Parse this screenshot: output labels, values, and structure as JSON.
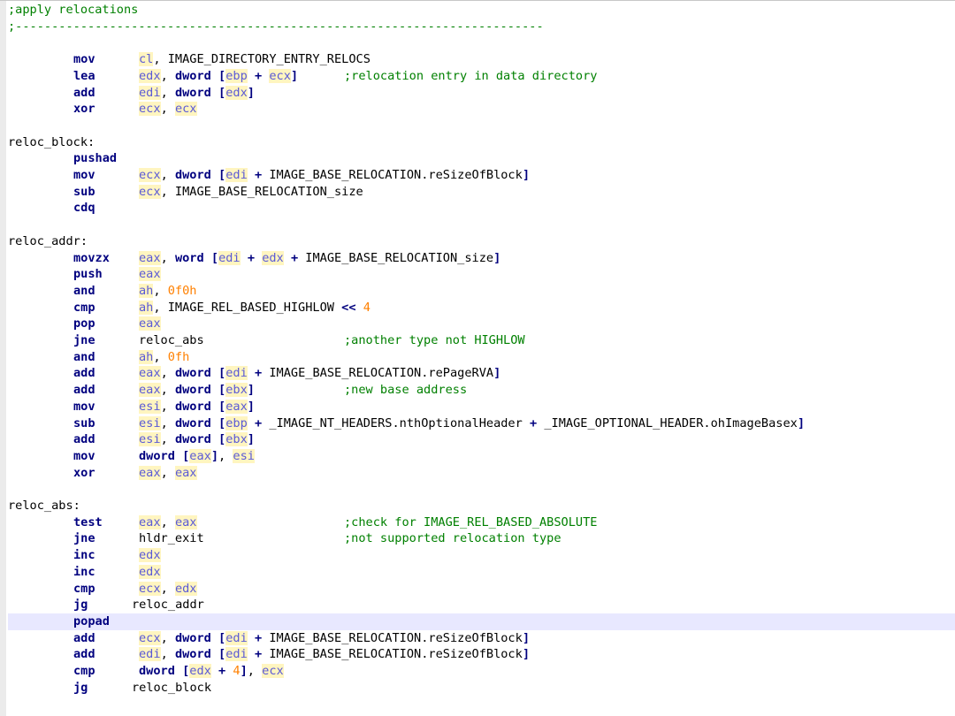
{
  "editor": {
    "lines": [
      {
        "type": "comment",
        "text": ";apply relocations"
      },
      {
        "type": "comment",
        "text": ";-------------------------------------------------------------------------"
      },
      {
        "type": "blank"
      },
      {
        "type": "instr",
        "mnemonic": "mov",
        "operands": [
          {
            "k": "reg",
            "t": "cl"
          },
          {
            "k": "plain",
            "t": ", IMAGE_DIRECTORY_ENTRY_RELOCS"
          }
        ]
      },
      {
        "type": "instr",
        "mnemonic": "lea",
        "operands": [
          {
            "k": "reg",
            "t": "edx"
          },
          {
            "k": "plain",
            "t": ", "
          },
          {
            "k": "kw",
            "t": "dword"
          },
          {
            "k": "plain",
            "t": " "
          },
          {
            "k": "kw",
            "t": "["
          },
          {
            "k": "reg",
            "t": "ebp"
          },
          {
            "k": "plain",
            "t": " "
          },
          {
            "k": "kw",
            "t": "+"
          },
          {
            "k": "plain",
            "t": " "
          },
          {
            "k": "reg",
            "t": "ecx"
          },
          {
            "k": "kw",
            "t": "]"
          }
        ],
        "comment": ";relocation entry in data directory"
      },
      {
        "type": "instr",
        "mnemonic": "add",
        "operands": [
          {
            "k": "reg",
            "t": "edi"
          },
          {
            "k": "plain",
            "t": ", "
          },
          {
            "k": "kw",
            "t": "dword"
          },
          {
            "k": "plain",
            "t": " "
          },
          {
            "k": "kw",
            "t": "["
          },
          {
            "k": "reg",
            "t": "edx"
          },
          {
            "k": "kw",
            "t": "]"
          }
        ]
      },
      {
        "type": "instr",
        "mnemonic": "xor",
        "operands": [
          {
            "k": "reg",
            "t": "ecx"
          },
          {
            "k": "plain",
            "t": ", "
          },
          {
            "k": "reg",
            "t": "ecx"
          }
        ]
      },
      {
        "type": "blank"
      },
      {
        "type": "label",
        "text": "reloc_block:"
      },
      {
        "type": "instr",
        "mnemonic": "pushad",
        "operands": []
      },
      {
        "type": "instr",
        "mnemonic": "mov",
        "operands": [
          {
            "k": "reg",
            "t": "ecx"
          },
          {
            "k": "plain",
            "t": ", "
          },
          {
            "k": "kw",
            "t": "dword"
          },
          {
            "k": "plain",
            "t": " "
          },
          {
            "k": "kw",
            "t": "["
          },
          {
            "k": "reg",
            "t": "edi"
          },
          {
            "k": "plain",
            "t": " "
          },
          {
            "k": "kw",
            "t": "+"
          },
          {
            "k": "plain",
            "t": " IMAGE_BASE_RELOCATION.reSizeOfBlock"
          },
          {
            "k": "kw",
            "t": "]"
          }
        ]
      },
      {
        "type": "instr",
        "mnemonic": "sub",
        "operands": [
          {
            "k": "reg",
            "t": "ecx"
          },
          {
            "k": "plain",
            "t": ", IMAGE_BASE_RELOCATION_size"
          }
        ]
      },
      {
        "type": "instr",
        "mnemonic": "cdq",
        "operands": []
      },
      {
        "type": "blank"
      },
      {
        "type": "label",
        "text": "reloc_addr:"
      },
      {
        "type": "instr",
        "mnemonic": "movzx",
        "operands": [
          {
            "k": "reg",
            "t": "eax"
          },
          {
            "k": "plain",
            "t": ", "
          },
          {
            "k": "kw",
            "t": "word"
          },
          {
            "k": "plain",
            "t": " "
          },
          {
            "k": "kw",
            "t": "["
          },
          {
            "k": "reg",
            "t": "edi"
          },
          {
            "k": "plain",
            "t": " "
          },
          {
            "k": "kw",
            "t": "+"
          },
          {
            "k": "plain",
            "t": " "
          },
          {
            "k": "reg",
            "t": "edx"
          },
          {
            "k": "plain",
            "t": " "
          },
          {
            "k": "kw",
            "t": "+"
          },
          {
            "k": "plain",
            "t": " IMAGE_BASE_RELOCATION_size"
          },
          {
            "k": "kw",
            "t": "]"
          }
        ]
      },
      {
        "type": "instr",
        "mnemonic": "push",
        "operands": [
          {
            "k": "reg",
            "t": "eax"
          }
        ]
      },
      {
        "type": "instr",
        "mnemonic": "and",
        "operands": [
          {
            "k": "reg",
            "t": "ah"
          },
          {
            "k": "plain",
            "t": ", "
          },
          {
            "k": "num",
            "t": "0f0h"
          }
        ]
      },
      {
        "type": "instr",
        "mnemonic": "cmp",
        "operands": [
          {
            "k": "reg",
            "t": "ah"
          },
          {
            "k": "plain",
            "t": ", IMAGE_REL_BASED_HIGHLOW "
          },
          {
            "k": "kw",
            "t": "<<"
          },
          {
            "k": "plain",
            "t": " "
          },
          {
            "k": "num",
            "t": "4"
          }
        ]
      },
      {
        "type": "instr",
        "mnemonic": "pop",
        "operands": [
          {
            "k": "reg",
            "t": "eax"
          }
        ]
      },
      {
        "type": "instr",
        "mnemonic": "jne",
        "operands": [
          {
            "k": "plain",
            "t": "reloc_abs"
          }
        ],
        "comment": ";another type not HIGHLOW"
      },
      {
        "type": "instr",
        "mnemonic": "and",
        "operands": [
          {
            "k": "reg",
            "t": "ah"
          },
          {
            "k": "plain",
            "t": ", "
          },
          {
            "k": "num",
            "t": "0fh"
          }
        ]
      },
      {
        "type": "instr",
        "mnemonic": "add",
        "operands": [
          {
            "k": "reg",
            "t": "eax"
          },
          {
            "k": "plain",
            "t": ", "
          },
          {
            "k": "kw",
            "t": "dword"
          },
          {
            "k": "plain",
            "t": " "
          },
          {
            "k": "kw",
            "t": "["
          },
          {
            "k": "reg",
            "t": "edi"
          },
          {
            "k": "plain",
            "t": " "
          },
          {
            "k": "kw",
            "t": "+"
          },
          {
            "k": "plain",
            "t": " IMAGE_BASE_RELOCATION.rePageRVA"
          },
          {
            "k": "kw",
            "t": "]"
          }
        ]
      },
      {
        "type": "instr",
        "mnemonic": "add",
        "operands": [
          {
            "k": "reg",
            "t": "eax"
          },
          {
            "k": "plain",
            "t": ", "
          },
          {
            "k": "kw",
            "t": "dword"
          },
          {
            "k": "plain",
            "t": " "
          },
          {
            "k": "kw",
            "t": "["
          },
          {
            "k": "reg",
            "t": "ebx"
          },
          {
            "k": "kw",
            "t": "]"
          }
        ],
        "comment": ";new base address"
      },
      {
        "type": "instr",
        "mnemonic": "mov",
        "operands": [
          {
            "k": "reg",
            "t": "esi"
          },
          {
            "k": "plain",
            "t": ", "
          },
          {
            "k": "kw",
            "t": "dword"
          },
          {
            "k": "plain",
            "t": " "
          },
          {
            "k": "kw",
            "t": "["
          },
          {
            "k": "reg",
            "t": "eax"
          },
          {
            "k": "kw",
            "t": "]"
          }
        ]
      },
      {
        "type": "instr",
        "mnemonic": "sub",
        "operands": [
          {
            "k": "reg",
            "t": "esi"
          },
          {
            "k": "plain",
            "t": ", "
          },
          {
            "k": "kw",
            "t": "dword"
          },
          {
            "k": "plain",
            "t": " "
          },
          {
            "k": "kw",
            "t": "["
          },
          {
            "k": "reg",
            "t": "ebp"
          },
          {
            "k": "plain",
            "t": " "
          },
          {
            "k": "kw",
            "t": "+"
          },
          {
            "k": "plain",
            "t": " _IMAGE_NT_HEADERS.nthOptionalHeader "
          },
          {
            "k": "kw",
            "t": "+"
          },
          {
            "k": "plain",
            "t": " _IMAGE_OPTIONAL_HEADER.ohImageBasex"
          },
          {
            "k": "kw",
            "t": "]"
          }
        ]
      },
      {
        "type": "instr",
        "mnemonic": "add",
        "operands": [
          {
            "k": "reg",
            "t": "esi"
          },
          {
            "k": "plain",
            "t": ", "
          },
          {
            "k": "kw",
            "t": "dword"
          },
          {
            "k": "plain",
            "t": " "
          },
          {
            "k": "kw",
            "t": "["
          },
          {
            "k": "reg",
            "t": "ebx"
          },
          {
            "k": "kw",
            "t": "]"
          }
        ]
      },
      {
        "type": "instr",
        "mnemonic": "mov",
        "operands": [
          {
            "k": "kw",
            "t": "dword"
          },
          {
            "k": "plain",
            "t": " "
          },
          {
            "k": "kw",
            "t": "["
          },
          {
            "k": "reg",
            "t": "eax"
          },
          {
            "k": "kw",
            "t": "]"
          },
          {
            "k": "plain",
            "t": ", "
          },
          {
            "k": "reg",
            "t": "esi"
          }
        ]
      },
      {
        "type": "instr",
        "mnemonic": "xor",
        "operands": [
          {
            "k": "reg",
            "t": "eax"
          },
          {
            "k": "plain",
            "t": ", "
          },
          {
            "k": "reg",
            "t": "eax"
          }
        ]
      },
      {
        "type": "blank"
      },
      {
        "type": "label",
        "text": "reloc_abs:"
      },
      {
        "type": "instr",
        "mnemonic": "test",
        "operands": [
          {
            "k": "reg",
            "t": "eax"
          },
          {
            "k": "plain",
            "t": ", "
          },
          {
            "k": "reg",
            "t": "eax"
          }
        ],
        "comment": ";check for IMAGE_REL_BASED_ABSOLUTE"
      },
      {
        "type": "instr",
        "mnemonic": "jne",
        "operands": [
          {
            "k": "plain",
            "t": "hldr_exit"
          }
        ],
        "comment": ";not supported relocation type"
      },
      {
        "type": "instr",
        "mnemonic": "inc",
        "operands": [
          {
            "k": "reg",
            "t": "edx"
          }
        ]
      },
      {
        "type": "instr",
        "mnemonic": "inc",
        "operands": [
          {
            "k": "reg",
            "t": "edx"
          }
        ]
      },
      {
        "type": "instr",
        "mnemonic": "cmp",
        "operands": [
          {
            "k": "reg",
            "t": "ecx"
          },
          {
            "k": "plain",
            "t": ", "
          },
          {
            "k": "reg",
            "t": "edx"
          }
        ]
      },
      {
        "type": "instr",
        "mnemonic": "jg",
        "operands": [
          {
            "k": "plain",
            "t": "reloc_addr"
          }
        ],
        "indent": "short"
      },
      {
        "type": "instr",
        "mnemonic": "popad",
        "operands": [],
        "current": true
      },
      {
        "type": "instr",
        "mnemonic": "add",
        "operands": [
          {
            "k": "reg",
            "t": "ecx"
          },
          {
            "k": "plain",
            "t": ", "
          },
          {
            "k": "kw",
            "t": "dword"
          },
          {
            "k": "plain",
            "t": " "
          },
          {
            "k": "kw",
            "t": "["
          },
          {
            "k": "reg",
            "t": "edi"
          },
          {
            "k": "plain",
            "t": " "
          },
          {
            "k": "kw",
            "t": "+"
          },
          {
            "k": "plain",
            "t": " IMAGE_BASE_RELOCATION.reSizeOfBlock"
          },
          {
            "k": "kw",
            "t": "]"
          }
        ]
      },
      {
        "type": "instr",
        "mnemonic": "add",
        "operands": [
          {
            "k": "reg",
            "t": "edi"
          },
          {
            "k": "plain",
            "t": ", "
          },
          {
            "k": "kw",
            "t": "dword"
          },
          {
            "k": "plain",
            "t": " "
          },
          {
            "k": "kw",
            "t": "["
          },
          {
            "k": "reg",
            "t": "edi"
          },
          {
            "k": "plain",
            "t": " "
          },
          {
            "k": "kw",
            "t": "+"
          },
          {
            "k": "plain",
            "t": " IMAGE_BASE_RELOCATION.reSizeOfBlock"
          },
          {
            "k": "kw",
            "t": "]"
          }
        ]
      },
      {
        "type": "instr",
        "mnemonic": "cmp",
        "operands": [
          {
            "k": "kw",
            "t": "dword"
          },
          {
            "k": "plain",
            "t": " "
          },
          {
            "k": "kw",
            "t": "["
          },
          {
            "k": "reg",
            "t": "edx"
          },
          {
            "k": "plain",
            "t": " "
          },
          {
            "k": "kw",
            "t": "+"
          },
          {
            "k": "plain",
            "t": " "
          },
          {
            "k": "num",
            "t": "4"
          },
          {
            "k": "kw",
            "t": "]"
          },
          {
            "k": "plain",
            "t": ", "
          },
          {
            "k": "reg",
            "t": "ecx"
          }
        ]
      },
      {
        "type": "instr",
        "mnemonic": "jg",
        "operands": [
          {
            "k": "plain",
            "t": "reloc_block"
          }
        ],
        "indent": "short"
      }
    ]
  },
  "colors": {
    "mnemonic": "#00007f",
    "register": "#5a5ad6",
    "register_highlight": "#fff5c0",
    "number": "#ff8000",
    "comment": "#008000",
    "current_line": "#e8e8ff",
    "gutter": "#ebebeb"
  }
}
